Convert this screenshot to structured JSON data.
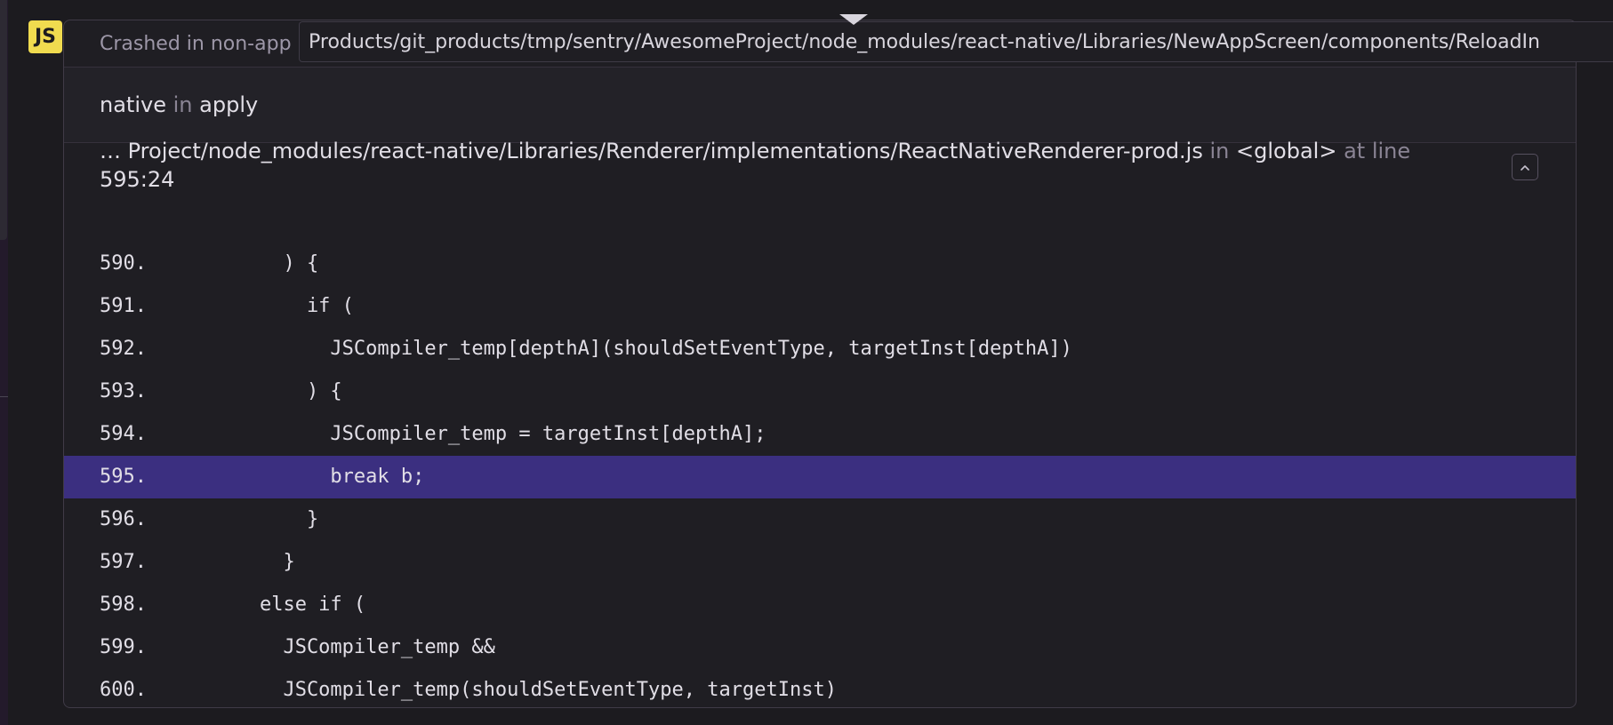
{
  "badge": {
    "label": "JS",
    "color": "#f0db4f"
  },
  "crashed_label": "Crashed in non-app",
  "tooltip_path": "Products/git_products/tmp/sentry/AwesomeProject/node_modules/react-native/Libraries/NewAppScreen/components/ReloadIn",
  "native_frame": {
    "module": "native",
    "in_word": "in",
    "function": "apply"
  },
  "frame": {
    "path": "… Project/node_modules/react-native/Libraries/Renderer/implementations/ReactNativeRenderer-prod.js",
    "in_word": "in",
    "function": "<global>",
    "at_line_label": "at line",
    "location": "595:24",
    "collapse_icon": "chevron-up-icon"
  },
  "highlight_color": "#3b2f80",
  "code_lines": [
    {
      "num": "590.",
      "code": "          ) {",
      "active": false
    },
    {
      "num": "591.",
      "code": "            if (",
      "active": false
    },
    {
      "num": "592.",
      "code": "              JSCompiler_temp[depthA](shouldSetEventType, targetInst[depthA])",
      "active": false
    },
    {
      "num": "593.",
      "code": "            ) {",
      "active": false
    },
    {
      "num": "594.",
      "code": "              JSCompiler_temp = targetInst[depthA];",
      "active": false
    },
    {
      "num": "595.",
      "code": "              break b;",
      "active": true
    },
    {
      "num": "596.",
      "code": "            }",
      "active": false
    },
    {
      "num": "597.",
      "code": "          }",
      "active": false
    },
    {
      "num": "598.",
      "code": "        else if (",
      "active": false
    },
    {
      "num": "599.",
      "code": "          JSCompiler_temp &&",
      "active": false
    },
    {
      "num": "600.",
      "code": "          JSCompiler_temp(shouldSetEventType, targetInst)",
      "active": false
    }
  ]
}
